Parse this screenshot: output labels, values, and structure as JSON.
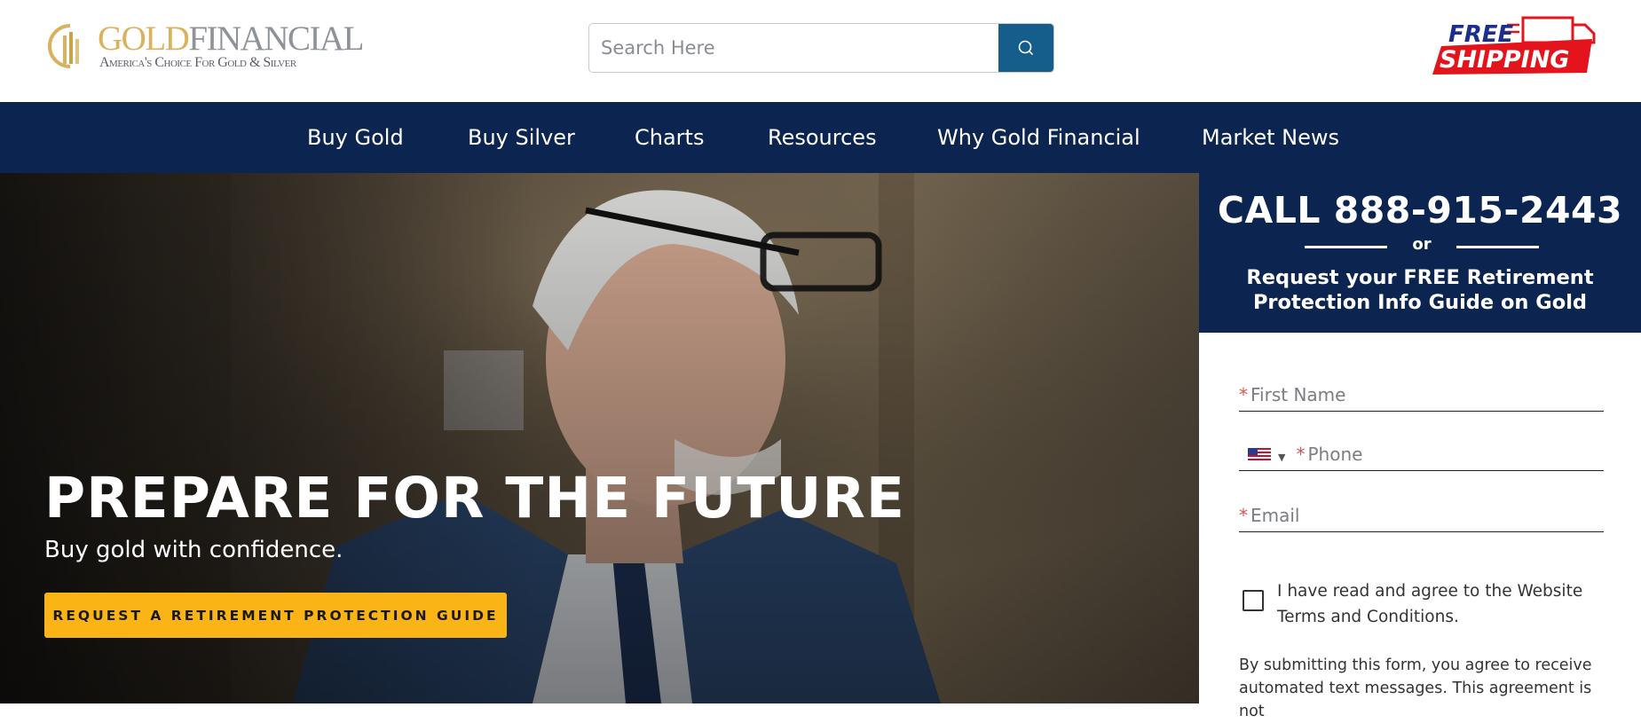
{
  "header": {
    "logo": {
      "brand_gold": "GOLD",
      "brand_financial": "FINANCIAL",
      "tagline": "America's Choice For Gold & Silver"
    },
    "search": {
      "placeholder": "Search Here"
    },
    "free_shipping": {
      "line1": "FREE",
      "line2": "SHIPPING"
    }
  },
  "nav": {
    "items": [
      {
        "label": "Buy Gold"
      },
      {
        "label": "Buy Silver"
      },
      {
        "label": "Charts"
      },
      {
        "label": "Resources"
      },
      {
        "label": "Why Gold Financial"
      },
      {
        "label": "Market News"
      }
    ]
  },
  "hero": {
    "title": "PREPARE FOR THE FUTURE",
    "subtitle": "Buy gold with confidence.",
    "cta": "REQUEST A RETIREMENT PROTECTION GUIDE"
  },
  "form": {
    "call": "CALL 888-915-2443",
    "or": "or",
    "request": "Request your FREE Retirement Protection Info Guide on Gold",
    "required_marker": "*",
    "fields": {
      "first_name": "First Name",
      "phone": "Phone",
      "email": "Email"
    },
    "agree_text": "I have read and agree to the Website Terms and Conditions.",
    "disclaimer": "By submitting this form, you agree to receive automated text messages. This agreement is not"
  },
  "colors": {
    "navy": "#0b2450",
    "cta_yellow": "#fbb416",
    "search_blue": "#155e8c",
    "logo_gold": "#d8b25c",
    "shipping_red": "#e3141c",
    "shipping_blue": "#1b2f8c"
  }
}
